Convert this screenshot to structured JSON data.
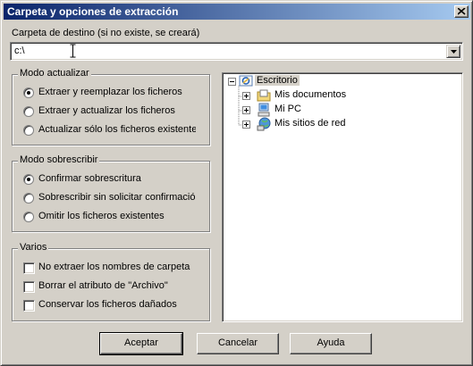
{
  "window": {
    "title": "Carpeta y opciones de extracción"
  },
  "destination": {
    "label": "Carpeta de destino (si no existe, se creará)",
    "value": "c:\\"
  },
  "update_mode": {
    "legend": "Modo actualizar",
    "options": [
      {
        "label": "Extraer y reemplazar los ficheros",
        "selected": true
      },
      {
        "label": "Extraer y actualizar los ficheros",
        "selected": false
      },
      {
        "label": "Actualizar sólo los ficheros existentes",
        "selected": false
      }
    ]
  },
  "overwrite_mode": {
    "legend": "Modo sobrescribir",
    "options": [
      {
        "label": "Confirmar sobrescritura",
        "selected": true
      },
      {
        "label": "Sobrescribir sin solicitar confirmación",
        "selected": false
      },
      {
        "label": "Omitir los ficheros existentes",
        "selected": false
      }
    ]
  },
  "misc": {
    "legend": "Varios",
    "options": [
      {
        "label": "No extraer los nombres de carpeta",
        "checked": false
      },
      {
        "label": "Borrar el atributo de \"Archivo\"",
        "checked": false
      },
      {
        "label": "Conservar los ficheros dañados",
        "checked": false
      }
    ]
  },
  "tree": {
    "root": {
      "label": "Escritorio",
      "icon": "desktop-icon"
    },
    "children": [
      {
        "label": "Mis documentos",
        "icon": "folder-icon"
      },
      {
        "label": "Mi PC",
        "icon": "computer-icon"
      },
      {
        "label": "Mis sitios de red",
        "icon": "network-icon"
      }
    ]
  },
  "buttons": {
    "ok": "Aceptar",
    "cancel": "Cancelar",
    "help": "Ayuda"
  }
}
